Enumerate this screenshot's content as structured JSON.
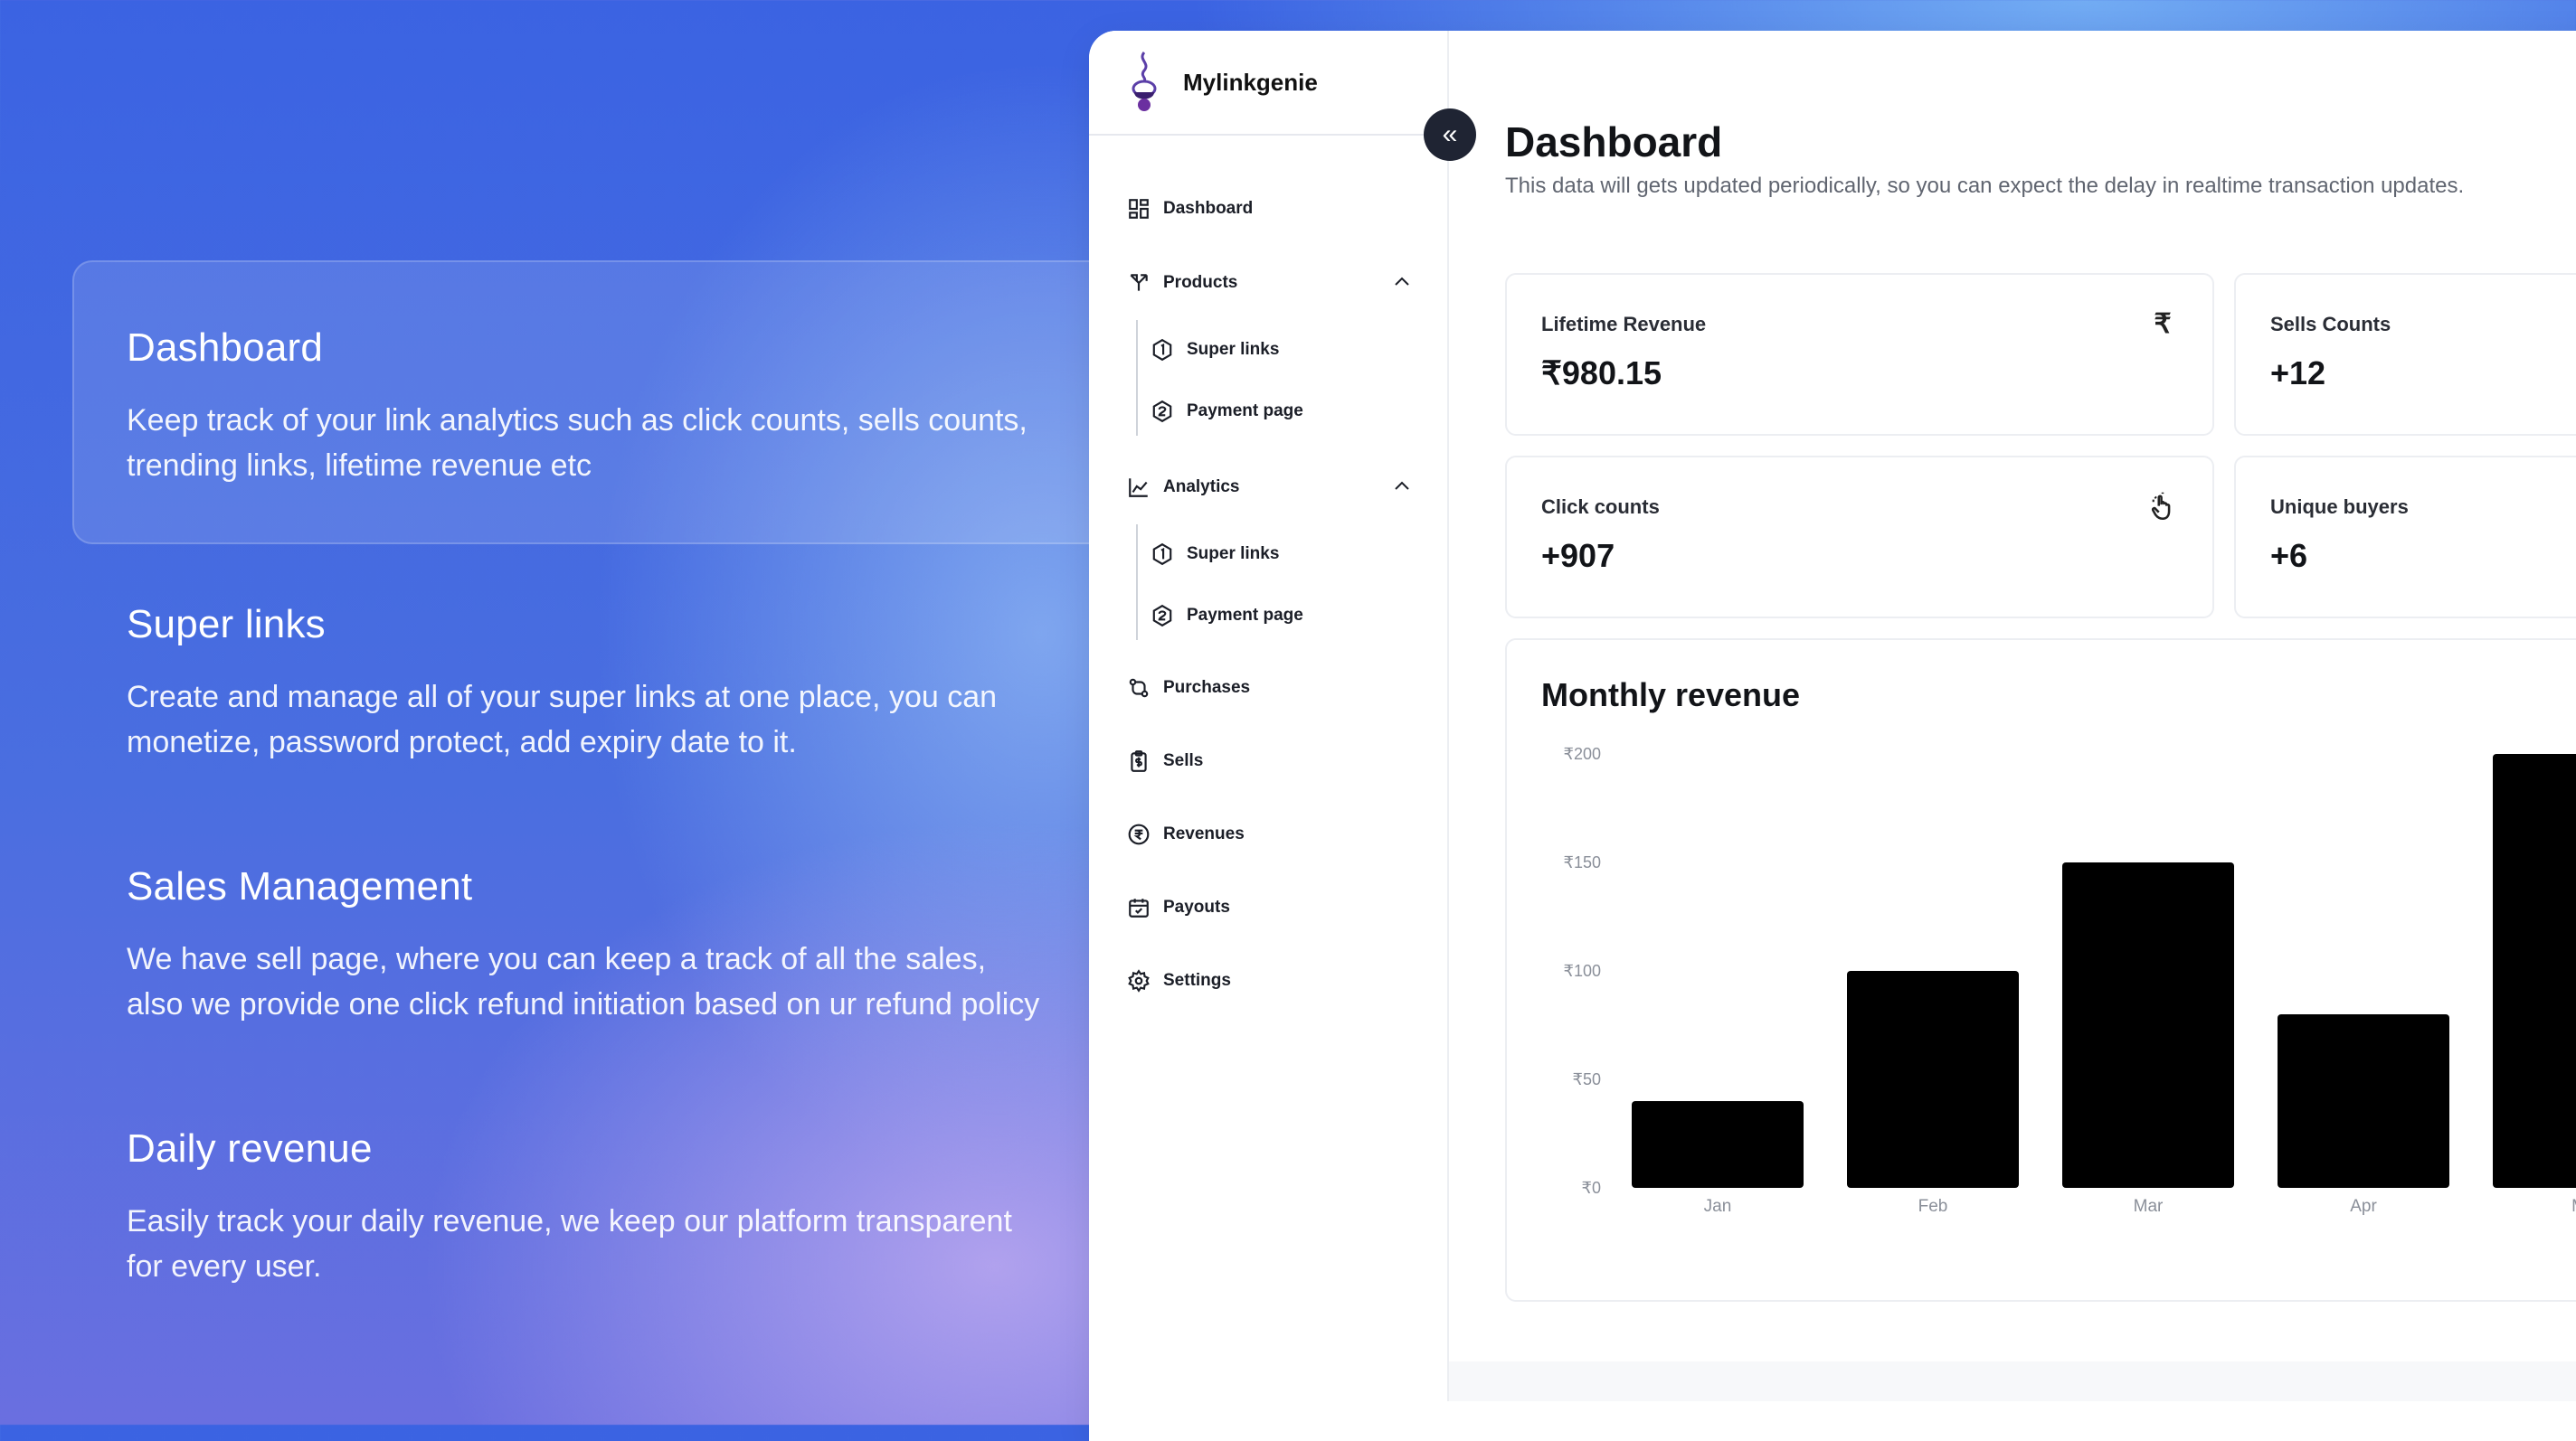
{
  "features": [
    {
      "title": "Dashboard",
      "text": "Keep track of your link analytics such as click counts, sells counts, trending links, lifetime revenue etc"
    },
    {
      "title": "Super links",
      "text": "Create and manage all of your super links at one place, you can monetize, password protect, add expiry date to it."
    },
    {
      "title": "Sales Management",
      "text": "We have sell page, where you can keep a track of all the sales, also we provide one click refund initiation based on ur refund policy"
    },
    {
      "title": "Daily revenue",
      "text": "Easily track your daily revenue, we keep our platform transparent for every user."
    }
  ],
  "app": {
    "brand": "Mylinkgenie",
    "collapse_icon": "«",
    "nav": {
      "dashboard": "Dashboard",
      "products": "Products",
      "products_super_links": "Super links",
      "products_payment_page": "Payment page",
      "analytics": "Analytics",
      "analytics_super_links": "Super links",
      "analytics_payment_page": "Payment page",
      "purchases": "Purchases",
      "sells": "Sells",
      "revenues": "Revenues",
      "payouts": "Payouts",
      "settings": "Settings"
    },
    "page": {
      "title": "Dashboard",
      "subtitle": "This data will gets updated periodically, so you can expect the delay in realtime transaction updates."
    },
    "stats": {
      "lifetime_revenue": {
        "label": "Lifetime Revenue",
        "value": "₹980.15",
        "icon": "₹"
      },
      "sells_counts": {
        "label": "Sells Counts",
        "value": "+12"
      },
      "click_counts": {
        "label": "Click counts",
        "value": "+907",
        "icon": "hand-pointer-icon"
      },
      "unique_buyers": {
        "label": "Unique buyers",
        "value": "+6"
      }
    }
  },
  "chart_data": {
    "type": "bar",
    "title": "Monthly revenue",
    "categories": [
      "Jan",
      "Feb",
      "Mar",
      "Apr",
      "M"
    ],
    "values": [
      40,
      100,
      150,
      80,
      200
    ],
    "yticks": [
      "₹0",
      "₹50",
      "₹100",
      "₹150",
      "₹200"
    ],
    "ylim": [
      0,
      200
    ],
    "bar_color": "#000000",
    "grid": false
  }
}
